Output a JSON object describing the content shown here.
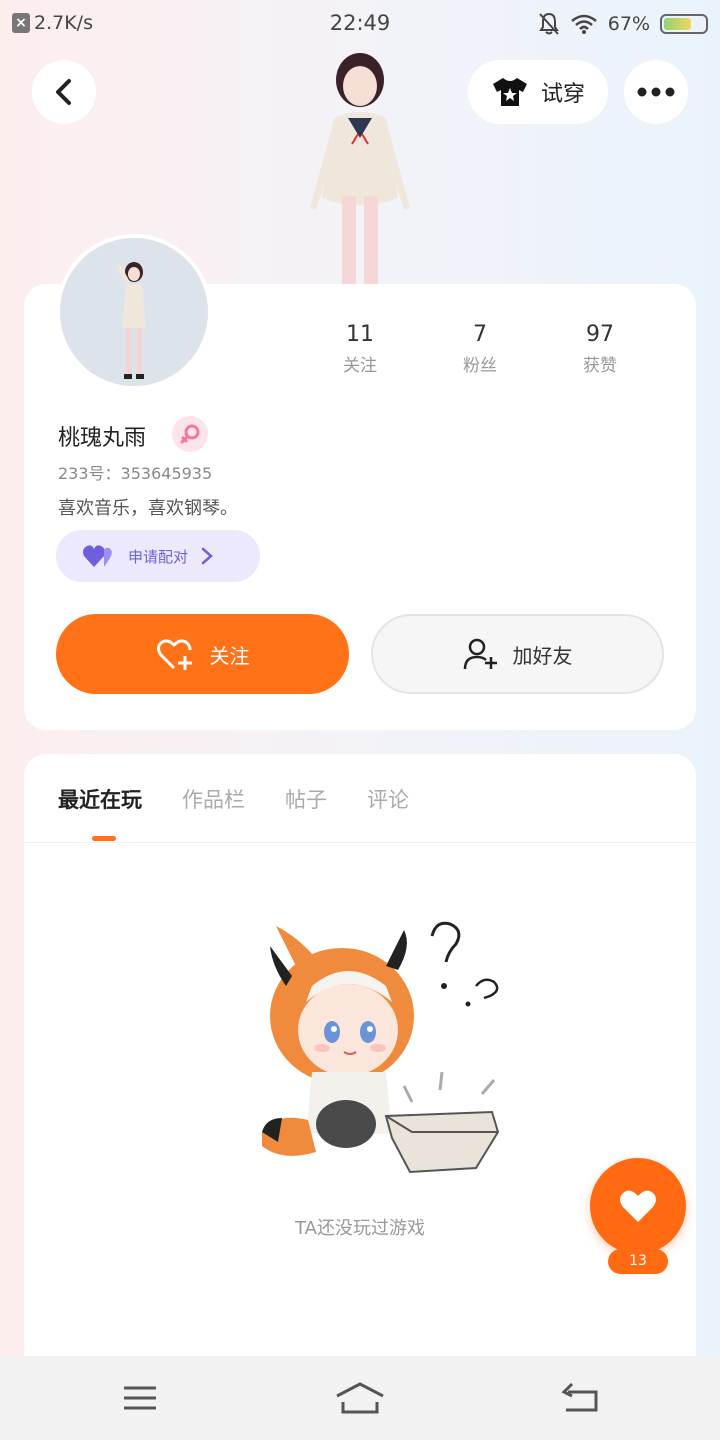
{
  "status_bar": {
    "net_speed": "2.7K/s",
    "time": "22:49",
    "battery": "67%",
    "battery_level": 0.67,
    "icons": [
      "notification-off-icon",
      "wifi-icon",
      "battery-icon"
    ]
  },
  "header": {
    "back_icon": "chevron-left-icon",
    "tryon_label": "试穿",
    "more_icon": "ellipsis-icon"
  },
  "profile": {
    "stats": [
      {
        "value": "11",
        "label": "关注"
      },
      {
        "value": "7",
        "label": "粉丝"
      },
      {
        "value": "97",
        "label": "获赞"
      }
    ],
    "nickname": "桃瑰丸雨",
    "gender_icon": "female-symbol-icon",
    "uid": "233号：353645935",
    "bio": "喜欢音乐，喜欢钢琴。",
    "pair_label": "申请配对",
    "follow_label": "关注",
    "add_friend_label": "加好友"
  },
  "tabs": [
    {
      "label": "最近在玩",
      "active": true
    },
    {
      "label": "作品栏",
      "active": false
    },
    {
      "label": "帖子",
      "active": false
    },
    {
      "label": "评论",
      "active": false
    }
  ],
  "empty_state": {
    "text": "TA还没玩过游戏"
  },
  "like_fab": {
    "count": "13"
  },
  "colors": {
    "accent": "#ff7217",
    "pair_bg": "#ebe9fb",
    "pair_text": "#6d62d8"
  }
}
